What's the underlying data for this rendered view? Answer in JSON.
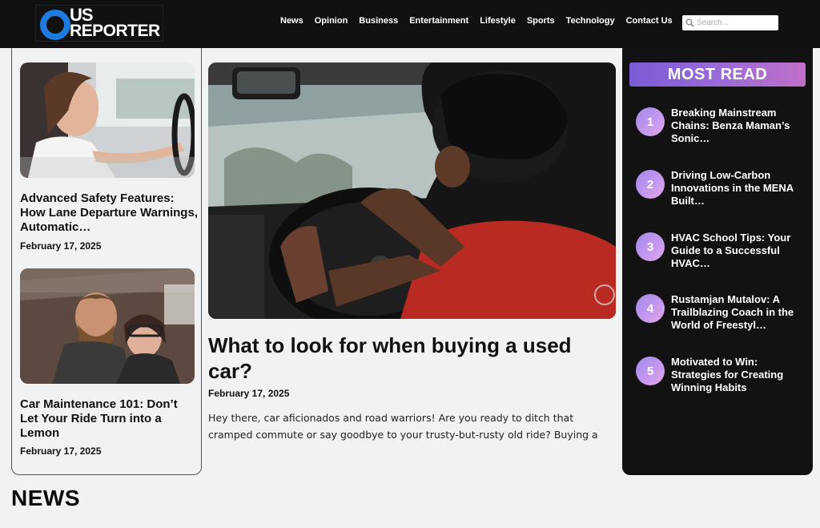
{
  "header": {
    "logo_line1": "US",
    "logo_line2": "REPORTER",
    "nav": [
      "News",
      "Opinion",
      "Business",
      "Entertainment",
      "Lifestyle",
      "Sports",
      "Technology",
      "Contact Us"
    ],
    "search_placeholder": "Search..."
  },
  "left_cards": [
    {
      "title": "Advanced Safety Features: How Lane Departure Warnings, Automatic…",
      "date": "February 17, 2025"
    },
    {
      "title": "Car Maintenance 101: Don’t Let Your Ride Turn into a Lemon",
      "date": "February 17, 2025"
    }
  ],
  "hero": {
    "title": "What to look for when buying a used car?",
    "date": "February 17, 2025",
    "excerpt": "Hey there, car aficionados and road warriors! Are you ready to ditch that cramped commute or say goodbye to your trusty-but-rusty old ride? Buying a"
  },
  "most_read": {
    "heading": "MOST READ",
    "items": [
      {
        "num": "1",
        "title": "Breaking Mainstream Chains: Benza Maman’s Sonic…"
      },
      {
        "num": "2",
        "title": "Driving Low-Carbon Innovations in the MENA Built…"
      },
      {
        "num": "3",
        "title": "HVAC School Tips: Your Guide to a Successful HVAC…"
      },
      {
        "num": "4",
        "title": "Rustamjan Mutalov: A Trailblazing Coach in the World of Freestyl…"
      },
      {
        "num": "5",
        "title": "Motivated to Win: Strategies for Creating Winning Habits"
      }
    ]
  },
  "section_heading": "NEWS",
  "colors": {
    "header_bg": "#111111",
    "logo_ring": "#1e7be0",
    "banner_start": "#7b5cd6",
    "banner_end": "#c070c8",
    "most_read_bg": "#121212",
    "page_bg": "#f1f2f4"
  }
}
